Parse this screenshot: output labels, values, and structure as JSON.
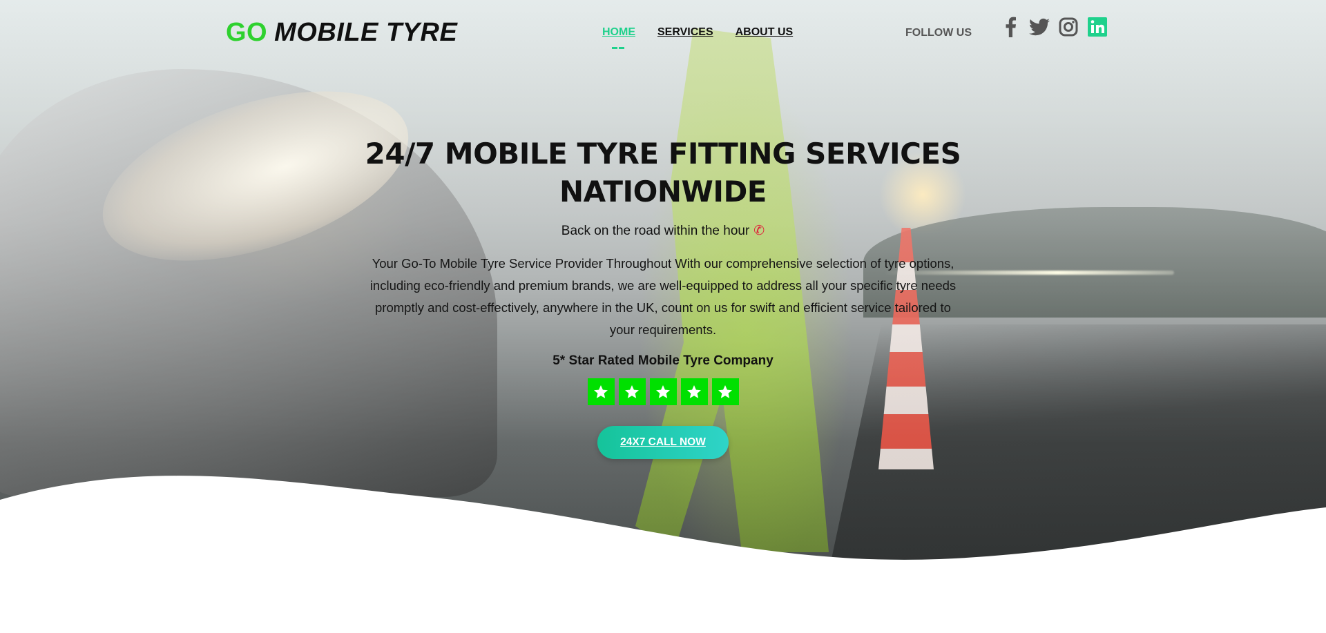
{
  "brand": {
    "go": "GO",
    "rest": "MOBILE TYRE"
  },
  "nav": {
    "items": [
      {
        "label": "HOME",
        "active": true
      },
      {
        "label": "SERVICES",
        "active": false
      },
      {
        "label": "ABOUT US",
        "active": false
      }
    ]
  },
  "social": {
    "follow_label": "FOLLOW US",
    "icons": [
      "facebook-icon",
      "twitter-icon",
      "instagram-icon",
      "linkedin-icon"
    ]
  },
  "hero": {
    "title": "24/7 MOBILE TYRE FITTING SERVICES NATIONWIDE",
    "tagline": "Back on the road within the hour",
    "tagline_icon": "phone-icon",
    "description": "Your Go-To Mobile Tyre Service Provider Throughout With our comprehensive selection of tyre options, including eco-friendly and premium brands, we are well-equipped to address all your specific tyre needs promptly and cost-effectively, anywhere in the UK, count on us for swift and efficient service tailored to your requirements.",
    "rating_label": "5* Star Rated Mobile Tyre Company",
    "rating": 5,
    "cta_label": "24X7 CALL NOW"
  },
  "colors": {
    "brand_green": "#2ed12e",
    "accent": "#1fd18c",
    "star": "#00e000",
    "linkedin": "#1fd18c"
  }
}
